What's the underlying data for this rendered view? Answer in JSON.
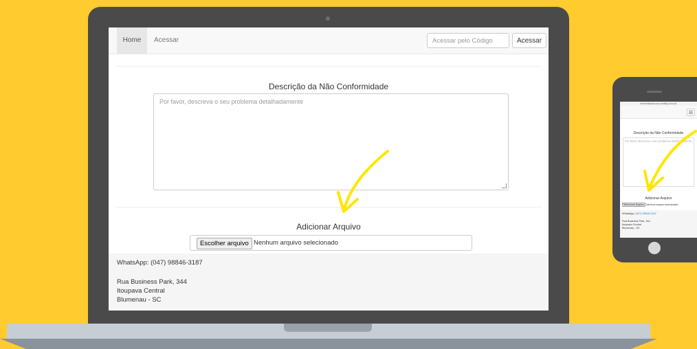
{
  "desktop": {
    "nav": {
      "home": "Home",
      "acessar": "Acessar",
      "code_placeholder": "Acessar pelo Código",
      "code_button": "Acessar"
    },
    "form": {
      "description_title": "Descrição da Não Conformidade",
      "description_placeholder": "Por favor, descreva o seu problema detalhadamente",
      "file_title": "Adicionar Arquivo",
      "file_button": "Escolher arquivo",
      "file_status": "Nenhum arquivo selecionado"
    },
    "footer": {
      "whatsapp": "WhatsApp: (047) 98846-3187",
      "address_line1": "Rua Business Park, 344",
      "address_line2": "Itoupava Central",
      "address_line3": "Blumenau - SC"
    }
  },
  "mobile": {
    "url": "● feedbacknoox.netlify.com.br",
    "description_title": "Descrição da Não Conformidade",
    "description_placeholder": "Por favor, descreva o seu problema detalhadamente",
    "file_title": "Adicionar Arquivo",
    "file_button": "Selecionar Arquivo",
    "file_status": "Nenhum arquivo selecionado",
    "whatsapp_label": "WhatsApp: ",
    "whatsapp_number": "(047) 98846-3187",
    "address_line1": "Rua Business Park, 344",
    "address_line2": "Itoupava Central",
    "address_line3": "Blumenau - SC"
  },
  "colors": {
    "background": "#FFCB2E",
    "arrow": "#FFE600",
    "device": "#4a4a4a"
  }
}
